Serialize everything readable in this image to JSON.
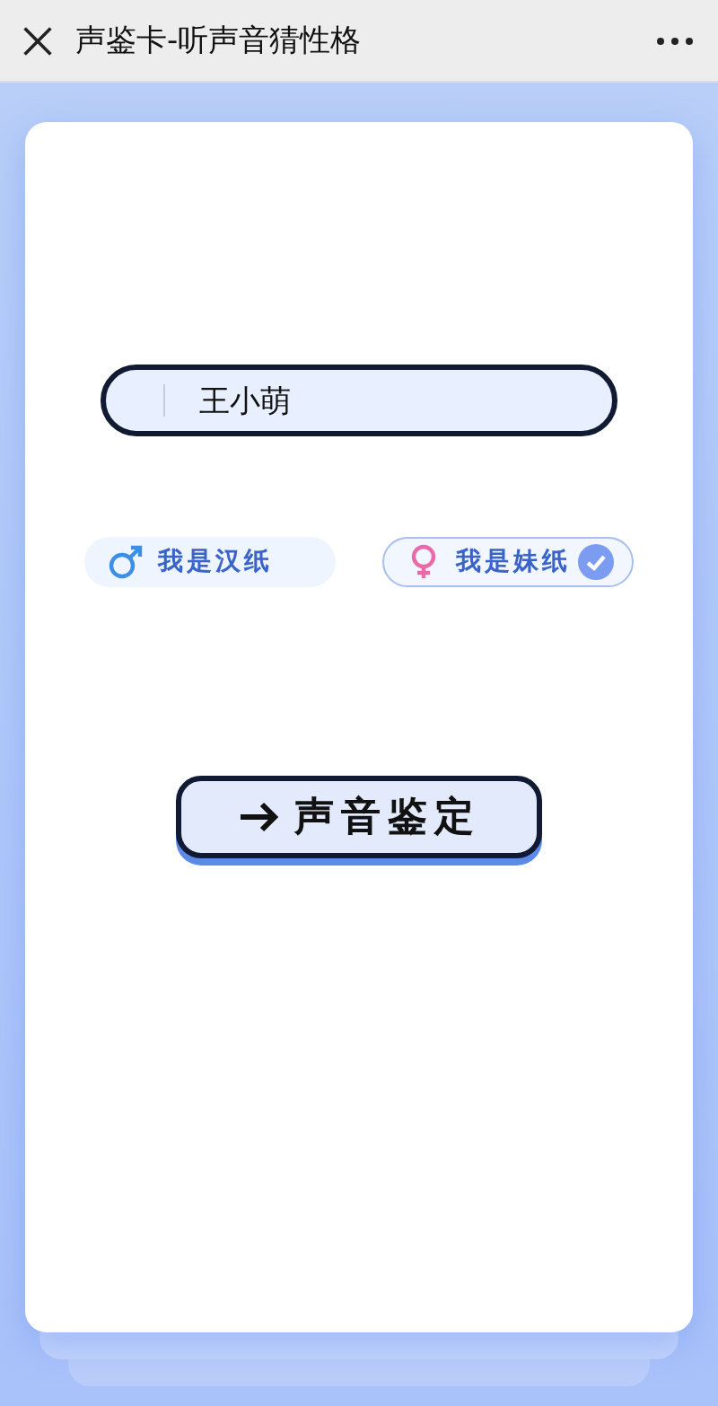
{
  "window": {
    "title": "声鉴卡-听声音猜性格"
  },
  "name_field": {
    "value": "王小萌"
  },
  "genders": [
    {
      "kind": "male",
      "label": "我是汉纸",
      "selected": false
    },
    {
      "kind": "female",
      "label": "我是妹纸",
      "selected": true
    }
  ],
  "submit": {
    "label": "声音鉴定"
  }
}
